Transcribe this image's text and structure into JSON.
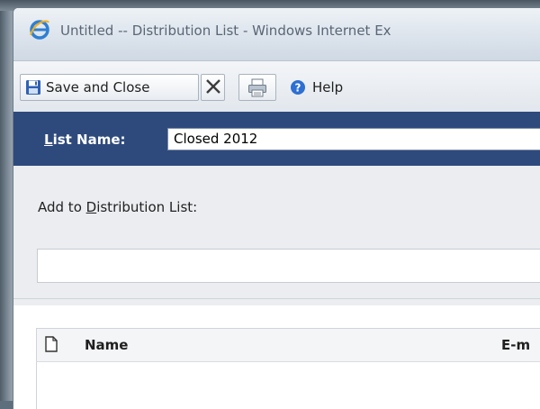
{
  "window": {
    "title": "Untitled -- Distribution List - Windows Internet Ex"
  },
  "toolbar": {
    "save_close_label": "Save and Close",
    "help_label": "Help"
  },
  "form": {
    "list_name_label_first": "L",
    "list_name_label_rest": "ist Name:",
    "list_name_value": "Closed 2012",
    "add_label_prefix": "Add to ",
    "add_label_underlined": "D",
    "add_label_suffix": "istribution List:",
    "add_input_value": ""
  },
  "grid": {
    "columns": [
      "Name",
      "E-m"
    ]
  },
  "colors": {
    "list_name_bar": "#2e4a7d",
    "form_background": "#ebedf0"
  },
  "icons": {
    "title": "internet-explorer-icon",
    "save": "floppy-disk-icon",
    "close": "close-x-icon",
    "print": "print-icon",
    "help": "help-question-icon",
    "grid_type": "document-icon"
  }
}
